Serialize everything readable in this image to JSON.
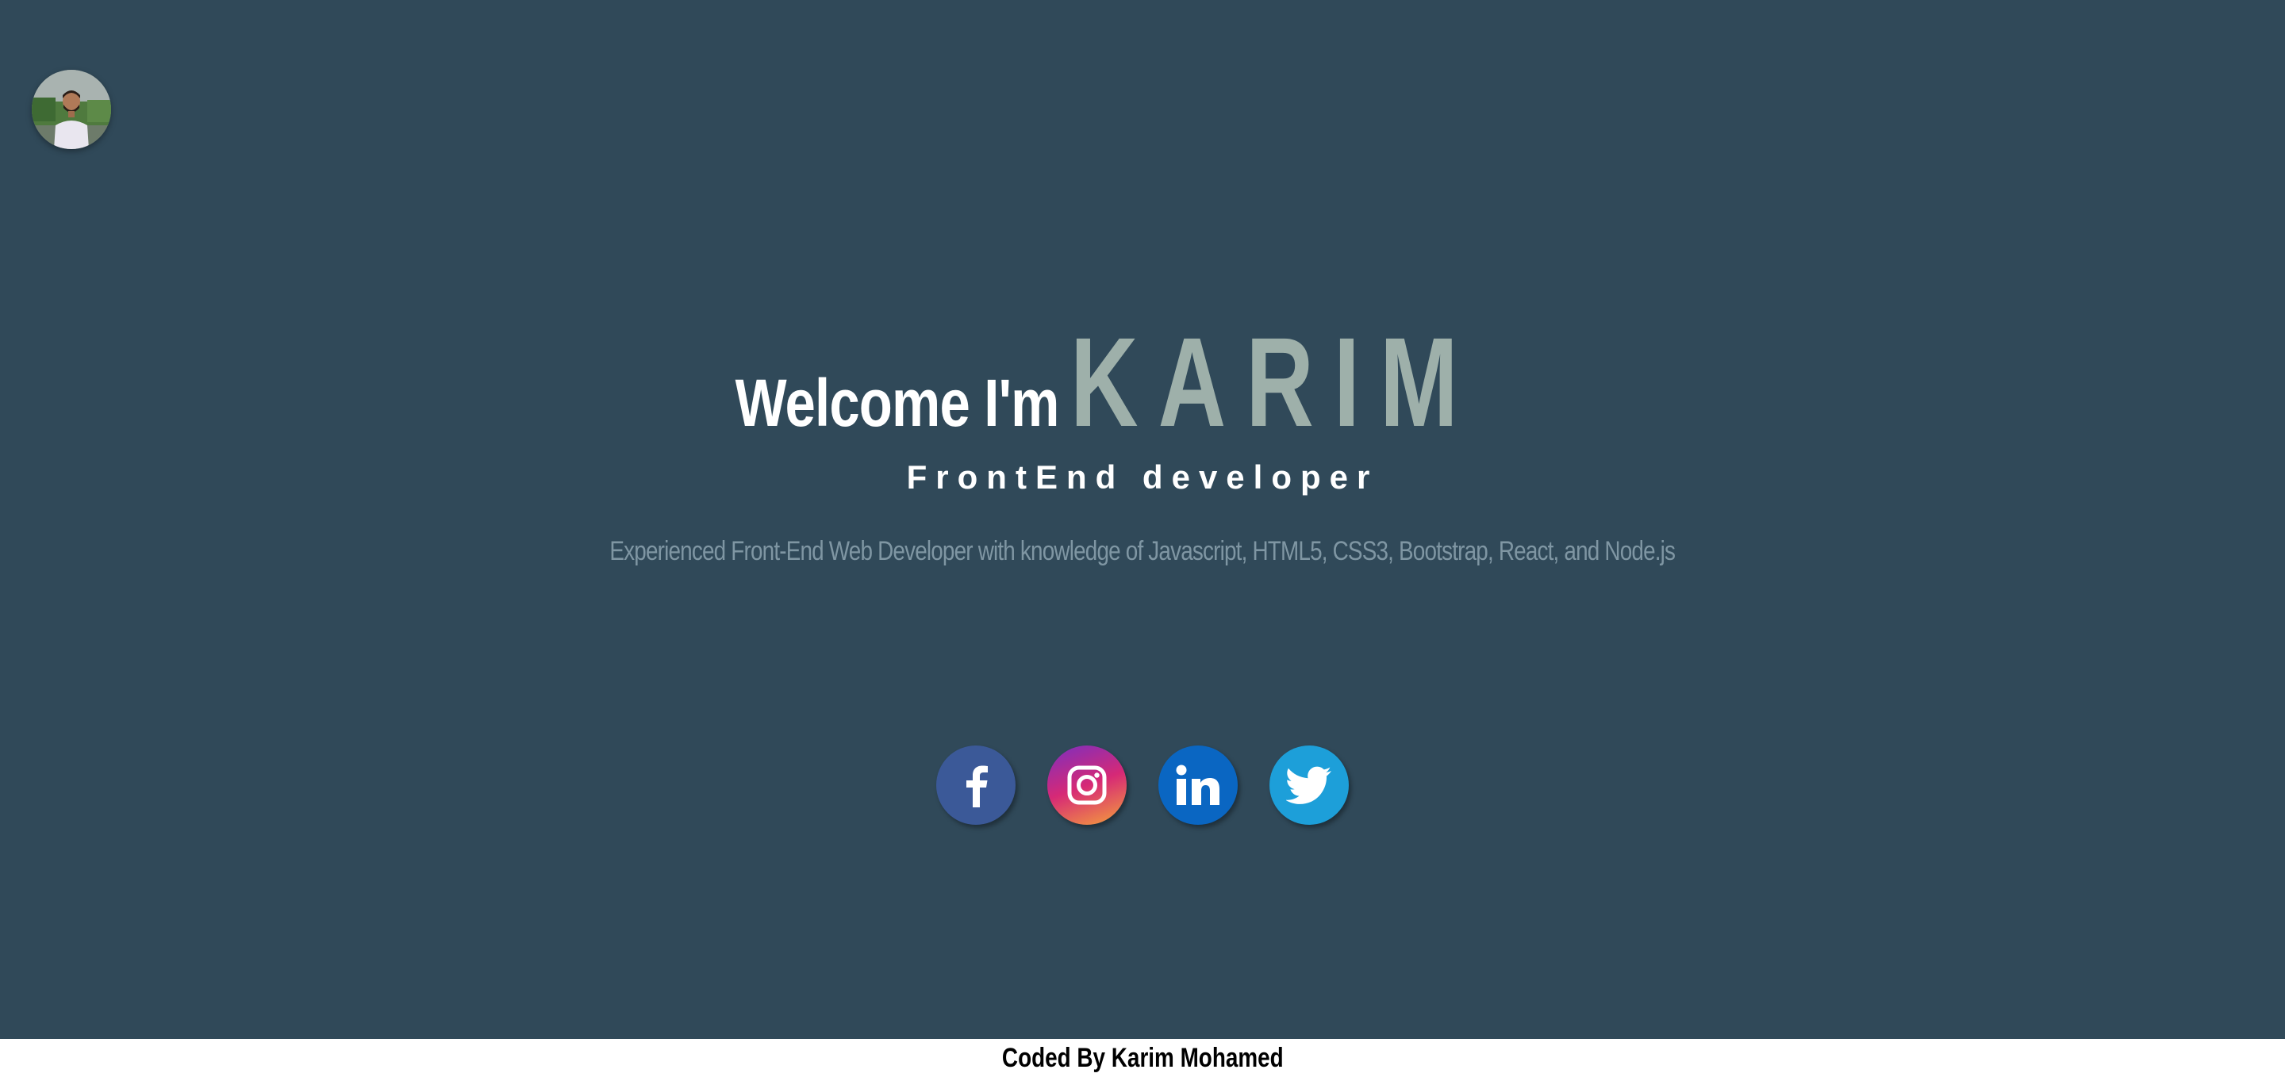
{
  "profile": {
    "avatar_icon": "profile-photo"
  },
  "hero": {
    "greeting": "Welcome I'm",
    "name": "KARIM",
    "role": "FrontEnd developer",
    "bio": "Experienced Front-End Web Developer with knowledge of Javascript, HTML5, CSS3, Bootstrap, React, and Node.js"
  },
  "socials": [
    {
      "icon": "facebook-icon",
      "color": "#3b5998"
    },
    {
      "icon": "instagram-icon",
      "color": "#d62976"
    },
    {
      "icon": "linkedin-icon",
      "color": "#0a66c2"
    },
    {
      "icon": "twitter-icon",
      "color": "#1d9fd9"
    }
  ],
  "footer": {
    "credit": "Coded By Karim Mohamed"
  },
  "colors": {
    "background": "#304959",
    "accent": "#9eb0aa",
    "muted_text": "#7f96a3",
    "footer_bg": "#ffffff"
  }
}
